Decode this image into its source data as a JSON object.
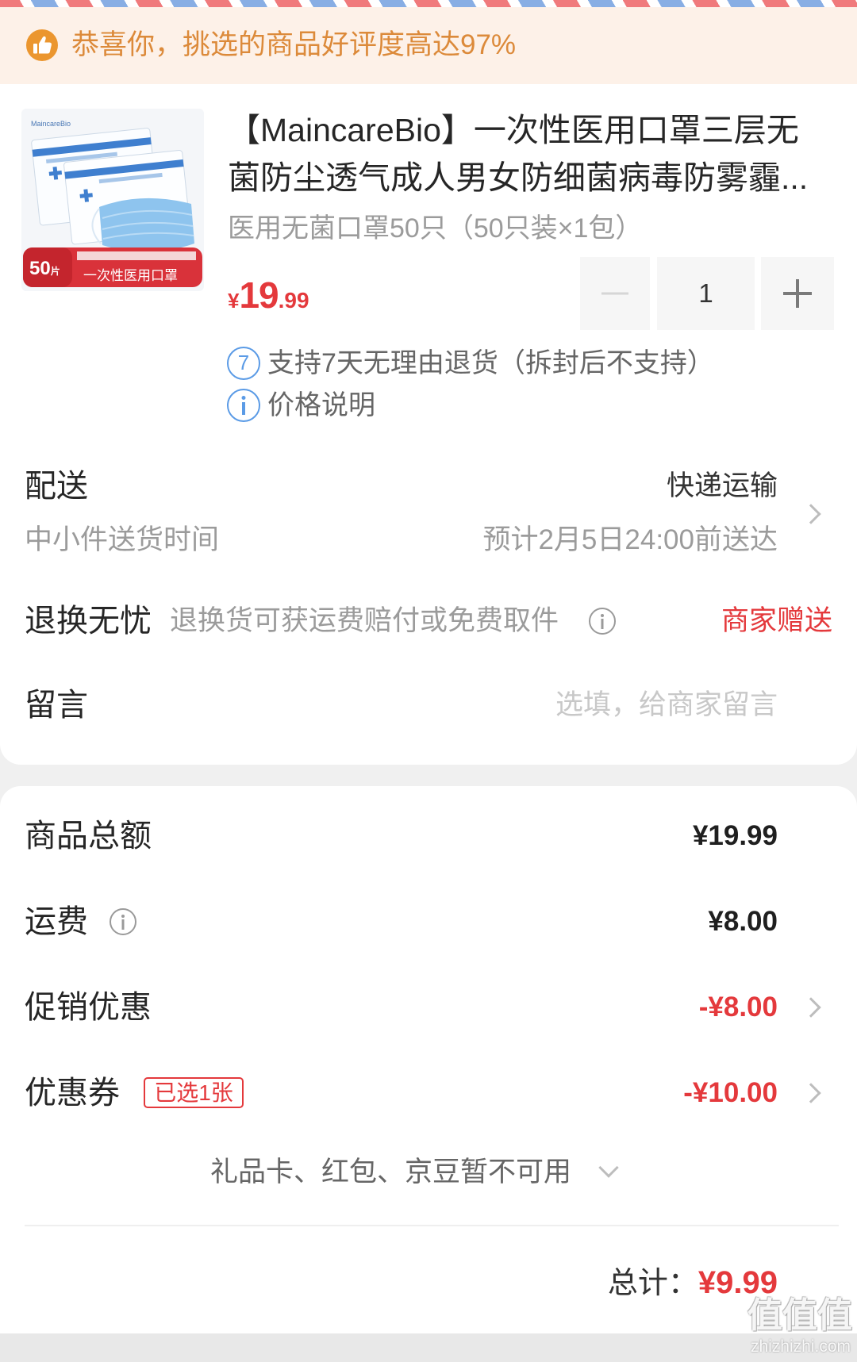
{
  "colors": {
    "accent_red": "#e4393c",
    "banner_text": "#dc8a3a",
    "banner_bg": "#fdf1e8",
    "banner_icon": "#eb962f",
    "icon_blue": "#5b9be6"
  },
  "icons": {
    "banner": "thumbs-up-icon",
    "info": "info-icon",
    "chevron_right": "chevron-right-icon",
    "chevron_down": "chevron-down-icon",
    "decrease": "minus-icon",
    "increase": "plus-icon"
  },
  "banner": {
    "text": "恭喜你，挑选的商品好评度高达97%"
  },
  "product": {
    "image": {
      "brand": "MaincareBio",
      "count": "50",
      "count_unit": "片",
      "label": "一次性医用口罩"
    },
    "title": [
      "【MaincareBio】一次性医用口罩三层无",
      "菌防尘透气成人男女防细菌病毒防雾霾..."
    ],
    "spec": "医用无菌口罩50只（50只装×1包）",
    "price": {
      "currency": "¥",
      "integer": "19",
      "decimal": ".99"
    },
    "quantity": {
      "value": "1"
    },
    "services": [
      {
        "badge": "7",
        "text": "支持7天无理由退货（拆封后不支持）"
      },
      {
        "text": "价格说明"
      }
    ]
  },
  "delivery": {
    "label": "配送",
    "method": "快递运输",
    "time_label": "中小件送货时间",
    "time_value": "预计2月5日24:00前送达"
  },
  "return_service": {
    "label": "退换无忧",
    "desc": "退换货可获运费赔付或免费取件",
    "value": "商家赠送"
  },
  "message": {
    "label": "留言",
    "placeholder": "选填，给商家留言"
  },
  "summary": {
    "goods_total": {
      "label": "商品总额",
      "value": "¥19.99"
    },
    "shipping": {
      "label": "运费",
      "value": "¥8.00"
    },
    "promotion": {
      "label": "促销优惠",
      "value": "-¥8.00"
    },
    "coupon": {
      "label": "优惠券",
      "badge": "已选1张",
      "value": "-¥10.00"
    },
    "unavailable": "礼品卡、红包、京豆暂不可用",
    "total": {
      "label": "总计：",
      "value": "¥9.99"
    }
  },
  "watermark": {
    "mark": "值值值",
    "site": "zhizhizhi.com"
  }
}
